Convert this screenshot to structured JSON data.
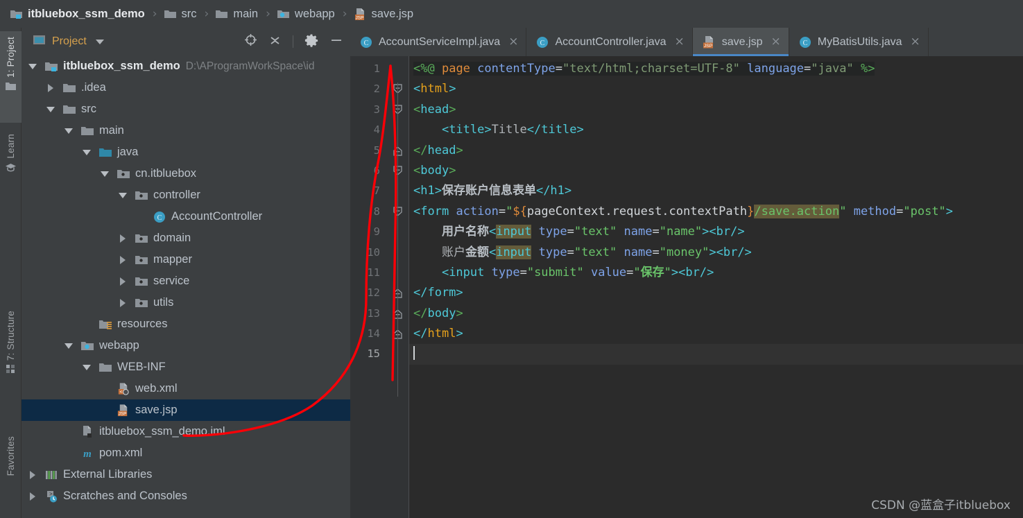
{
  "breadcrumb": {
    "items": [
      {
        "label": "itbluebox_ssm_demo",
        "icon": "module-folder-icon"
      },
      {
        "label": "src",
        "icon": "folder-icon"
      },
      {
        "label": "main",
        "icon": "folder-icon"
      },
      {
        "label": "webapp",
        "icon": "web-folder-icon"
      },
      {
        "label": "save.jsp",
        "icon": "jsp-file-icon"
      }
    ],
    "separator": "›"
  },
  "left_rail": {
    "top_tabs": [
      {
        "label": "1: Project",
        "icon": "project-folder-icon",
        "active": true
      },
      {
        "label": "Learn",
        "icon": "graduation-cap-icon",
        "active": false
      }
    ],
    "bottom_tabs": [
      {
        "label": "7: Structure",
        "icon": "structure-blocks-icon",
        "active": false
      },
      {
        "label": "Favorites",
        "icon": "favorites-icon",
        "active": false
      }
    ]
  },
  "project_panel": {
    "title": "Project",
    "actions": [
      {
        "name": "locate-in-tree-icon",
        "tooltip": "Select Opened File"
      },
      {
        "name": "collapse-all-icon",
        "tooltip": "Collapse All"
      },
      {
        "name": "gear-icon",
        "tooltip": "Settings"
      },
      {
        "name": "minimize-icon",
        "tooltip": "Hide"
      }
    ],
    "tree": [
      {
        "label": "itbluebox_ssm_demo",
        "path": "D:\\AProgramWorkSpace\\id",
        "indent": 0,
        "twisty": "expanded",
        "icon": "module-icon",
        "bold": true,
        "selected": false
      },
      {
        "label": ".idea",
        "path": "",
        "indent": 1,
        "twisty": "collapsed",
        "icon": "folder-icon",
        "bold": false,
        "selected": false
      },
      {
        "label": "src",
        "path": "",
        "indent": 1,
        "twisty": "expanded",
        "icon": "folder-icon",
        "bold": false,
        "selected": false
      },
      {
        "label": "main",
        "path": "",
        "indent": 2,
        "twisty": "expanded",
        "icon": "folder-icon",
        "bold": false,
        "selected": false
      },
      {
        "label": "java",
        "path": "",
        "indent": 3,
        "twisty": "expanded",
        "icon": "source-folder-icon",
        "bold": false,
        "selected": false
      },
      {
        "label": "cn.itbluebox",
        "path": "",
        "indent": 4,
        "twisty": "expanded",
        "icon": "package-icon",
        "bold": false,
        "selected": false
      },
      {
        "label": "controller",
        "path": "",
        "indent": 5,
        "twisty": "expanded",
        "icon": "package-icon",
        "bold": false,
        "selected": false
      },
      {
        "label": "AccountController",
        "path": "",
        "indent": 6,
        "twisty": "none",
        "icon": "java-class-icon",
        "bold": false,
        "selected": false
      },
      {
        "label": "domain",
        "path": "",
        "indent": 5,
        "twisty": "collapsed",
        "icon": "package-icon",
        "bold": false,
        "selected": false
      },
      {
        "label": "mapper",
        "path": "",
        "indent": 5,
        "twisty": "collapsed",
        "icon": "package-icon",
        "bold": false,
        "selected": false
      },
      {
        "label": "service",
        "path": "",
        "indent": 5,
        "twisty": "collapsed",
        "icon": "package-icon",
        "bold": false,
        "selected": false
      },
      {
        "label": "utils",
        "path": "",
        "indent": 5,
        "twisty": "collapsed",
        "icon": "package-icon",
        "bold": false,
        "selected": false
      },
      {
        "label": "resources",
        "path": "",
        "indent": 3,
        "twisty": "none",
        "icon": "resources-folder-icon",
        "bold": false,
        "selected": false
      },
      {
        "label": "webapp",
        "path": "",
        "indent": 2,
        "twisty": "expanded",
        "icon": "web-folder-icon",
        "bold": false,
        "selected": false
      },
      {
        "label": "WEB-INF",
        "path": "",
        "indent": 3,
        "twisty": "expanded",
        "icon": "folder-icon",
        "bold": false,
        "selected": false
      },
      {
        "label": "web.xml",
        "path": "",
        "indent": 4,
        "twisty": "none",
        "icon": "xml-file-icon",
        "bold": false,
        "selected": false
      },
      {
        "label": "save.jsp",
        "path": "",
        "indent": 4,
        "twisty": "none",
        "icon": "jsp-file-icon",
        "bold": false,
        "selected": true
      },
      {
        "label": "itbluebox_ssm_demo.iml",
        "path": "",
        "indent": 2,
        "twisty": "none",
        "icon": "iml-file-icon",
        "bold": false,
        "selected": false
      },
      {
        "label": "pom.xml",
        "path": "",
        "indent": 2,
        "twisty": "none",
        "icon": "maven-icon",
        "bold": false,
        "selected": false
      },
      {
        "label": "External Libraries",
        "path": "",
        "indent": 0,
        "twisty": "collapsed",
        "icon": "libraries-icon",
        "bold": false,
        "selected": false
      },
      {
        "label": "Scratches and Consoles",
        "path": "",
        "indent": 0,
        "twisty": "collapsed",
        "icon": "scratches-icon",
        "bold": false,
        "selected": false
      }
    ]
  },
  "editor": {
    "tabs": [
      {
        "label": "AccountServiceImpl.java",
        "icon": "java-class-icon",
        "active": false,
        "close": "×"
      },
      {
        "label": "AccountController.java",
        "icon": "java-class-icon",
        "active": false,
        "close": "×"
      },
      {
        "label": "save.jsp",
        "icon": "jsp-file-icon",
        "active": true,
        "close": "×"
      },
      {
        "label": "MyBatisUtils.java",
        "icon": "java-class-icon",
        "active": false,
        "close": "×"
      }
    ],
    "line_numbers": [
      1,
      2,
      3,
      4,
      5,
      6,
      7,
      8,
      9,
      10,
      11,
      12,
      13,
      14,
      15
    ],
    "current_line": 15,
    "folds": {
      "2": "open",
      "3": "open",
      "5": "close",
      "6": "open",
      "8": "open",
      "12": "close",
      "13": "close",
      "14": "close"
    },
    "code_lines": [
      {
        "n": 1,
        "text": "<%@ page contentType=\"text/html;charset=UTF-8\" language=\"java\" %>"
      },
      {
        "n": 2,
        "text": "<html>"
      },
      {
        "n": 3,
        "text": "<head>"
      },
      {
        "n": 4,
        "text": "    <title>Title</title>"
      },
      {
        "n": 5,
        "text": "</head>"
      },
      {
        "n": 6,
        "text": "<body>"
      },
      {
        "n": 7,
        "text": "<h1>保存账户信息表单</h1>"
      },
      {
        "n": 8,
        "text": "<form action=\"${pageContext.request.contextPath}/save.action\" method=\"post\">"
      },
      {
        "n": 9,
        "text": "    用户名称<input type=\"text\" name=\"name\"><br/>"
      },
      {
        "n": 10,
        "text": "    账户金额<input type=\"text\" name=\"money\"><br/>"
      },
      {
        "n": 11,
        "text": "    <input type=\"submit\" value=\"保存\"><br/>"
      },
      {
        "n": 12,
        "text": "</form>"
      },
      {
        "n": 13,
        "text": "</body>"
      },
      {
        "n": 14,
        "text": "</html>"
      },
      {
        "n": 15,
        "text": ""
      }
    ]
  },
  "watermark": {
    "text": "CSDN @蓝盒子itbluebox"
  },
  "colors": {
    "panel_bg": "#3c3f41",
    "editor_bg": "#2b2b2b",
    "gutter_bg": "#313335",
    "selection_bg": "#0d2a45",
    "tab_active_bg": "#4e5254",
    "tab_underline": "#4a88c7",
    "annotation": "#fb0007",
    "accent_orange": "#d6a14d",
    "jsp_badge": "#c4703b"
  }
}
